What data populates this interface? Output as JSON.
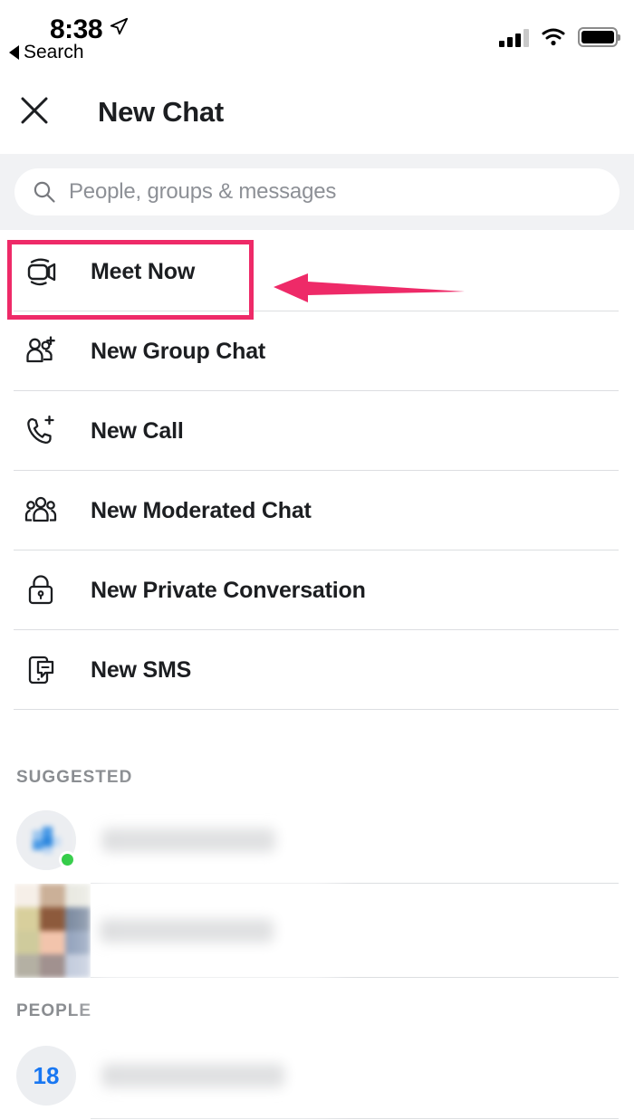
{
  "status_bar": {
    "time": "8:38",
    "back_label": "Search",
    "location_icon": "location-arrow-icon",
    "signal_icon": "cellular-signal-icon",
    "signal_bars_active": 3,
    "signal_bars_total": 4,
    "wifi_icon": "wifi-icon",
    "battery_icon": "battery-full-icon",
    "battery_level": 100
  },
  "nav": {
    "close_icon": "close-icon",
    "title": "New Chat"
  },
  "search": {
    "icon": "search-icon",
    "placeholder": "People, groups & messages",
    "value": ""
  },
  "menu": {
    "items": [
      {
        "label": "Meet Now",
        "icon": "video-camera-icon",
        "highlighted": true
      },
      {
        "label": "New Group Chat",
        "icon": "group-add-icon",
        "highlighted": false
      },
      {
        "label": "New Call",
        "icon": "phone-add-icon",
        "highlighted": false
      },
      {
        "label": "New Moderated Chat",
        "icon": "people-group-icon",
        "highlighted": false
      },
      {
        "label": "New Private Conversation",
        "icon": "lock-icon",
        "highlighted": false
      },
      {
        "label": "New SMS",
        "icon": "phone-message-icon",
        "highlighted": false
      }
    ]
  },
  "sections": {
    "suggested": {
      "header": "SUGGESTED",
      "rows": [
        {
          "avatar": "avatar-blurred-circle",
          "name": "",
          "online": true
        },
        {
          "avatar": "avatar-blurred-square",
          "name": "",
          "online": false
        }
      ]
    },
    "people": {
      "header": "PEOPLE",
      "rows": [
        {
          "avatar": "group-count-avatar",
          "count": "18",
          "name": ""
        }
      ]
    }
  },
  "annotation": {
    "highlight_color": "#ee2a68",
    "arrow_color": "#ee2a68",
    "arrow_icon": "arrow-left-annotation",
    "target": "Meet Now"
  }
}
